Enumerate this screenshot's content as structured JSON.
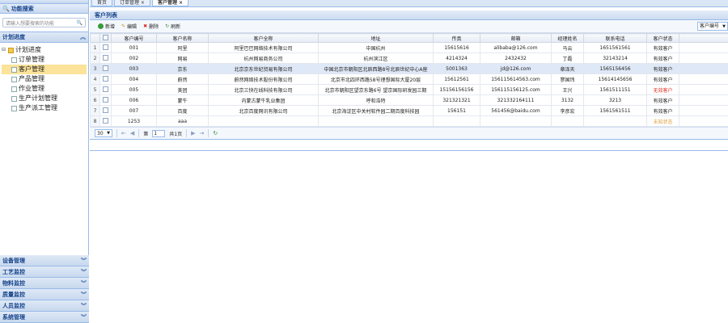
{
  "sidebar": {
    "search_title": "功能搜索",
    "search_placeholder": "请输入想要搜索的功能",
    "plan_section": "计划进度",
    "tree": {
      "root": "计划进度",
      "items": [
        {
          "label": "订单管理",
          "selected": false
        },
        {
          "label": "客户管理",
          "selected": true
        },
        {
          "label": "产品管理",
          "selected": false
        },
        {
          "label": "作业管理",
          "selected": false
        },
        {
          "label": "生产计划管理",
          "selected": false
        },
        {
          "label": "生产派工管理",
          "selected": false
        }
      ]
    },
    "bottom_sections": [
      "设备管理",
      "工艺监控",
      "物料监控",
      "质量监控",
      "人员监控",
      "系统管理"
    ]
  },
  "tabs": [
    "首页",
    "订单管理 ×",
    "客户管理 ×"
  ],
  "grid": {
    "title": "客户列表",
    "toolbar": {
      "add": "新增",
      "edit": "编辑",
      "delete": "删除",
      "refresh": "刷新",
      "column_select": "客户编号"
    },
    "columns": [
      "客户编号",
      "客户名称",
      "客户全称",
      "地址",
      "传真",
      "邮箱",
      "经理姓名",
      "联系电话",
      "客户状态"
    ],
    "rows": [
      [
        "001",
        "阿里",
        "阿里巴巴网络技术有限公司",
        "中国杭州",
        "15615616",
        "alibaba@126.com",
        "马云",
        "1651561561",
        "有效客户"
      ],
      [
        "002",
        "网易",
        "杭州网易商务公司",
        "杭州滨江区",
        "4214324",
        "2432432",
        "丁磊",
        "32143214",
        "有效客户"
      ],
      [
        "003",
        "京东",
        "北京京东世纪贸易有限公司",
        "中国北京市朝阳区北辰西路8号北辰世纪中心A座",
        "5001363",
        "jd@126.com",
        "章泽天",
        "1565156456",
        "有效客户"
      ],
      [
        "004",
        "蔚然",
        "蔚然网络技术股份有限公司",
        "北京市北四环西路58号理想国际大厦20层",
        "15612561",
        "156115614563.com",
        "寥国玮",
        "15614145656",
        "有效客户"
      ],
      [
        "005",
        "美团",
        "北京三快在线科技有限公司",
        "北京市朝阳区望京东路6号 望京国际研发园三期",
        "15156156156",
        "156115156125.com",
        "王兴",
        "1561511151",
        "无效客户"
      ],
      [
        "006",
        "蒙牛",
        "内蒙古蒙牛乳业集团",
        "呼和浩特",
        "321321321",
        "321332164111",
        "3132",
        "3213",
        "有效客户"
      ],
      [
        "007",
        "百度",
        "北京百度网讯有限公司",
        "北京海淀区中关村软件园二期百度科技园",
        "156151",
        "561456@baidu.com",
        "李彦宏",
        "1561561511",
        "有效客户"
      ],
      [
        "1253",
        "aaa",
        "",
        "",
        "",
        "",
        "",
        "",
        "未知状态"
      ]
    ],
    "selected_row": 3,
    "status_colors": {
      "有效客户": "#222222",
      "无效客户": "#dd3322",
      "未知状态": "#e0a040"
    }
  },
  "pager": {
    "page_size": "30",
    "page_label_before": "第",
    "page": "1",
    "page_label_after": "共1页"
  }
}
